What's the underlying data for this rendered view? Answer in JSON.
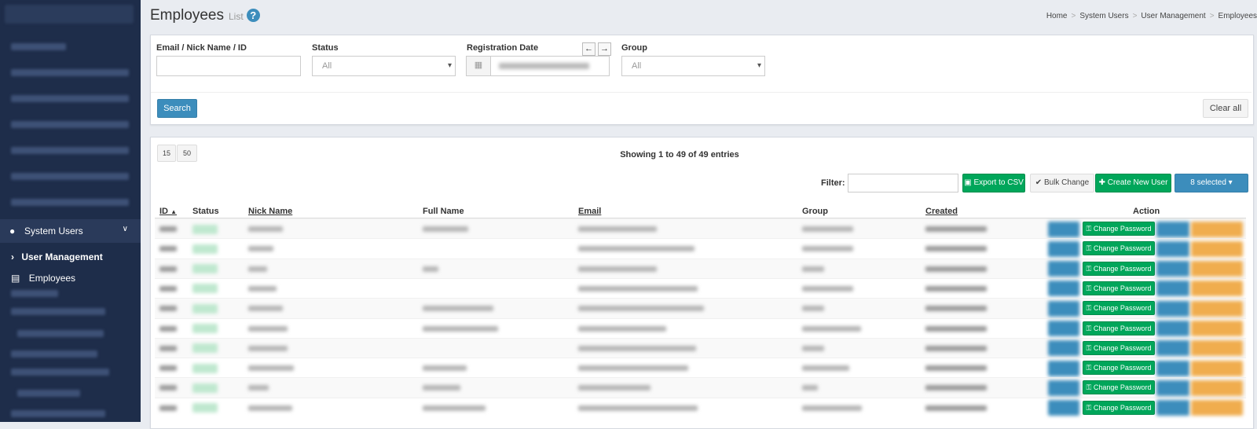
{
  "sidebar": {
    "active_item": {
      "label": "System Users",
      "icon": "user-icon"
    },
    "subitems": [
      {
        "label": "User Management",
        "icon": "chevron-right-icon"
      },
      {
        "label": "Employees",
        "icon": "id-badge-icon"
      }
    ]
  },
  "header": {
    "title": "Employees",
    "subtitle": "List",
    "help_glyph": "?",
    "breadcrumb": [
      "Home",
      "System Users",
      "User Management",
      "Employees"
    ]
  },
  "filters": {
    "email_label": "Email / Nick Name / ID",
    "email_value": "",
    "status_label": "Status",
    "status_value": "All",
    "date_label": "Registration Date",
    "group_label": "Group",
    "group_value": "All",
    "search_label": "Search",
    "clear_label": "Clear all"
  },
  "table_controls": {
    "page_sizes": [
      "15",
      "50"
    ],
    "showing": "Showing 1 to 49 of 49 entries",
    "filter_label": "Filter:",
    "filter_value": "",
    "export_label": "Export to CSV",
    "bulk_label": "Bulk Change",
    "create_label": "Create New User",
    "selected_label": "8 selected"
  },
  "columns": [
    "ID",
    "Status",
    "Nick Name",
    "Full Name",
    "Email",
    "Group",
    "Created",
    "Action"
  ],
  "row_action_label": "Change Password",
  "colors": {
    "sidebar": "#1e2d4a",
    "primary": "#3c8dbc",
    "success": "#00a65a",
    "warning": "#f0ad4e"
  }
}
